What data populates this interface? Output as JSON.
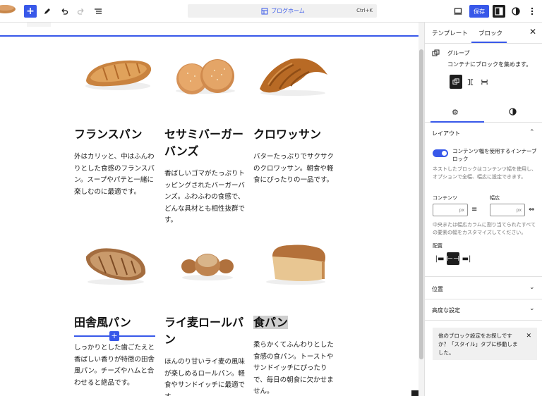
{
  "topbar": {
    "add_label": "+",
    "doc_title": "ブログホーム",
    "shortcut": "Ctrl+K",
    "save_label": "保存"
  },
  "products": [
    {
      "title": "フランスパン",
      "desc": "外はカリッと、中はふんわりとした食感のフランスパン。スープやパテと一緒に楽しむのに最適です。"
    },
    {
      "title": "セサミバーガーバンズ",
      "desc": "香ばしいゴマがたっぷりトッピングされたバーガーバンズ。ふわふわの食感で、どんな具材とも相性抜群です。"
    },
    {
      "title": "クロワッサン",
      "desc": "バターたっぷりでサクサクのクロワッサン。朝食や軽食にぴったりの一品です。"
    },
    {
      "title": "田舎風パン",
      "desc": "しっかりとした歯ごたえと香ばしい香りが特徴の田舎風パン。チーズやハムと合わせると絶品です。"
    },
    {
      "title": "ライ麦ロールパン",
      "desc": "ほんのり甘いライ麦の風味が楽しめるロールパン。軽食やサンドイッチに最適です。"
    },
    {
      "title": "食パン",
      "desc": "柔らかくてふんわりとした食感の食パン。トーストやサンドイッチにぴったりで、毎日の朝食に欠かせません。"
    }
  ],
  "sidebar": {
    "tab_template": "テンプレート",
    "tab_block": "ブロック",
    "block_name": "グループ",
    "block_desc": "コンテナにブロックを集めます。",
    "layout_heading": "レイアウト",
    "toggle_label": "コンテンツ幅を使用するインナーブロック",
    "toggle_help": "ネストしたブロックはコンテンツ幅を使用し、オプションで全幅、幅広に設定できます。",
    "content_label": "コンテンツ",
    "wide_label": "幅広",
    "unit": "px",
    "width_help": "中央または幅広カラムに割り当てられたすべての要素の幅をカスタマイズしてください。",
    "justify_label": "配置",
    "position_heading": "位置",
    "advanced_heading": "高度な設定",
    "notice": "他のブロック設定をお探しですか？「スタイル」タブに移動しました。"
  }
}
